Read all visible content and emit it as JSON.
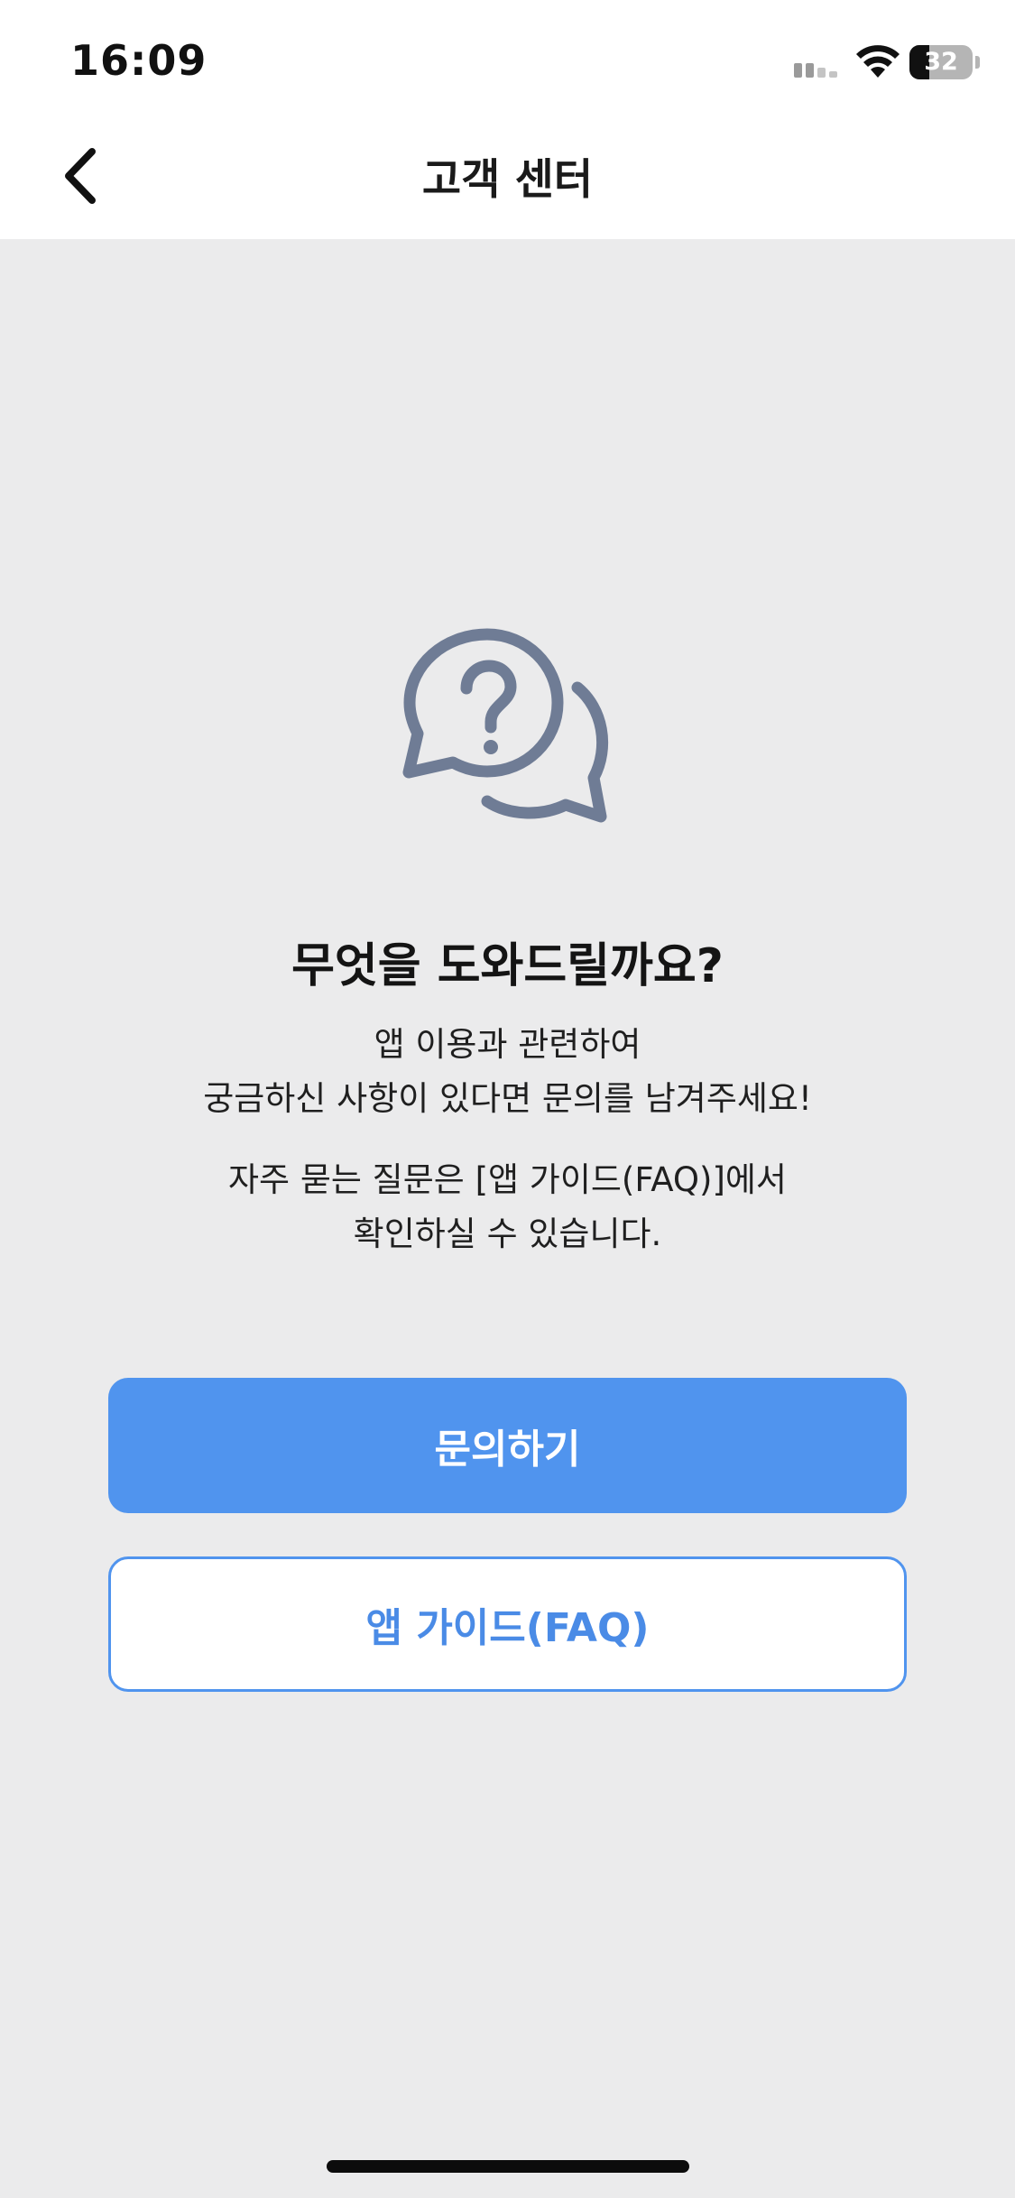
{
  "status_bar": {
    "time": "16:09",
    "battery_percent": 32,
    "battery_label": "32"
  },
  "header": {
    "title": "고객 센터"
  },
  "icons": {
    "back": "chevron-left-icon",
    "help": "question-chat-bubbles-icon",
    "signal": "cellular-signal-icon",
    "wifi": "wifi-icon",
    "battery": "battery-icon"
  },
  "content": {
    "title": "무엇을 도와드릴까요?",
    "description_lines": [
      "앱 이용과 관련하여",
      "궁금하신 사항이 있다면 문의를 남겨주세요!"
    ],
    "faq_hint_lines": [
      "자주 묻는 질문은 [앱 가이드(FAQ)]에서",
      "확인하실 수 있습니다."
    ]
  },
  "buttons": {
    "inquiry_label": "문의하기",
    "guide_label": "앱 가이드(FAQ)"
  },
  "colors": {
    "accent": "#5094ee",
    "background": "#ebebec",
    "icon": "#6f7c95",
    "header_bg": "#ffffff"
  }
}
